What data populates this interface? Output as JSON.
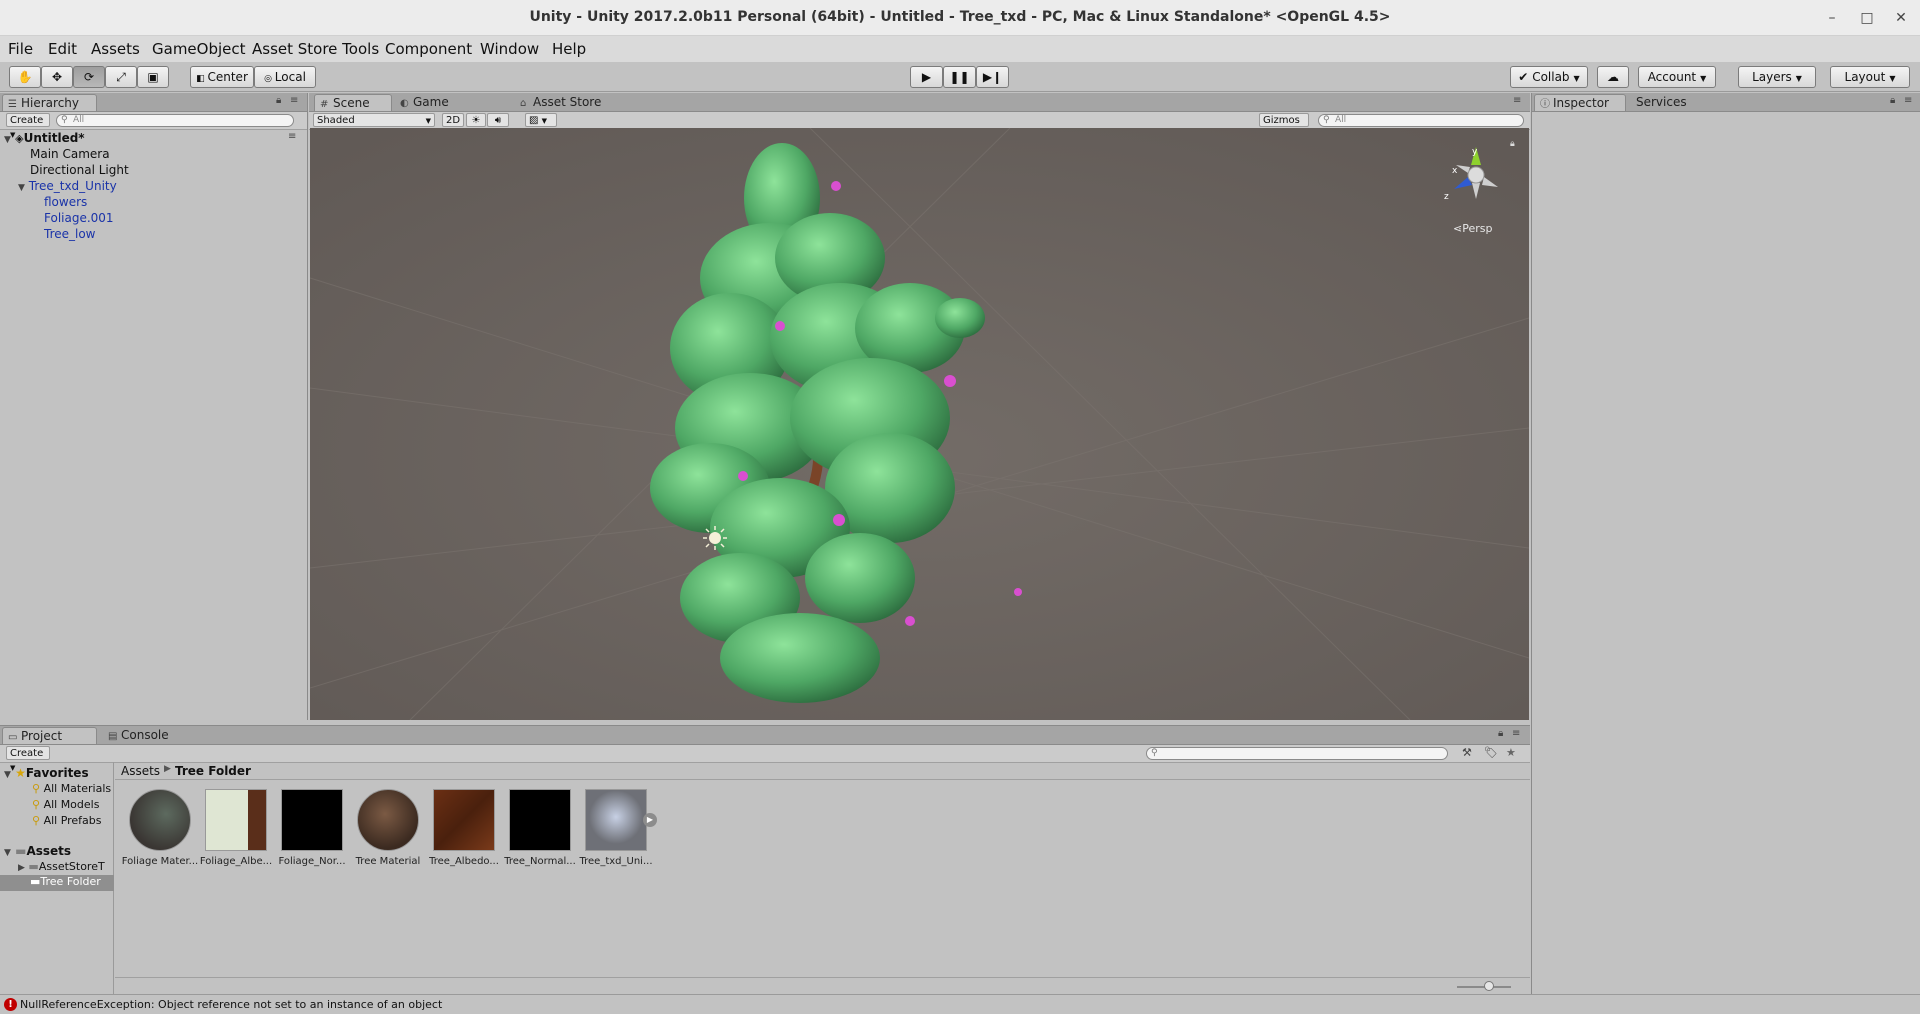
{
  "window": {
    "title": "Unity - Unity 2017.2.0b11 Personal (64bit) - Untitled - Tree_txd - PC, Mac & Linux Standalone* <OpenGL 4.5>",
    "min": "–",
    "max": "□",
    "close": "✕"
  },
  "menu": [
    "File",
    "Edit",
    "Assets",
    "GameObject",
    "Asset Store Tools",
    "Component",
    "Window",
    "Help"
  ],
  "toolbar": {
    "pivot": "Center",
    "space": "Local",
    "collab": "Collab",
    "account": "Account",
    "layers": "Layers",
    "layout": "Layout"
  },
  "hierarchy": {
    "tab": "Hierarchy",
    "create": "Create",
    "search_placeholder": "All",
    "scene": "Untitled*",
    "items": [
      "Main Camera",
      "Directional Light",
      "Tree_txd_Unity",
      "flowers",
      "Foliage.001",
      "Tree_low"
    ]
  },
  "scene": {
    "tabs": [
      "Scene",
      "Game",
      "Asset Store"
    ],
    "shading": "Shaded",
    "mode2d": "2D",
    "gizmos": "Gizmos",
    "search_placeholder": "All",
    "persp": "Persp",
    "axis_x": "x",
    "axis_y": "y",
    "axis_z": "z"
  },
  "inspector": {
    "tabs": [
      "Inspector",
      "Services"
    ]
  },
  "project": {
    "tabs": [
      "Project",
      "Console"
    ],
    "create": "Create",
    "favorites_label": "Favorites",
    "favorites": [
      "All Materials",
      "All Models",
      "All Prefabs"
    ],
    "assets_label": "Assets",
    "folders": [
      "AssetStoreT",
      "Tree Folder"
    ],
    "breadcrumb_root": "Assets",
    "breadcrumb_current": "Tree Folder",
    "assets": [
      "Foliage Mater...",
      "Foliage_Albe...",
      "Foliage_Nor...",
      "Tree Material",
      "Tree_Albedo...",
      "Tree_Normal...",
      "Tree_txd_Uni..."
    ]
  },
  "status": {
    "message": "NullReferenceException: Object reference not set to an instance of an object",
    "color": "#c00000"
  }
}
